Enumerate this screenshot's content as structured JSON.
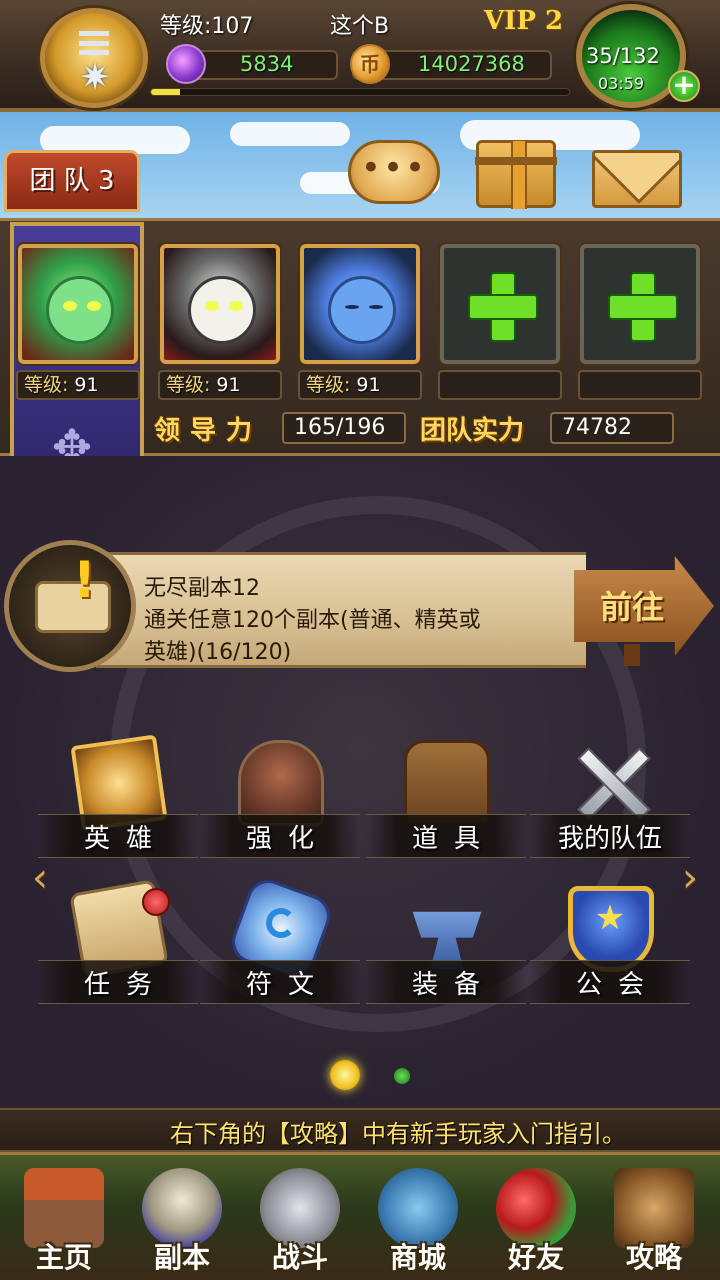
{
  "header": {
    "level_text": "等级:107",
    "player_name": "这个B",
    "vip_text": "VIP 2",
    "gems": "5834",
    "gold": "14027368",
    "gold_icon_glyph": "币",
    "exp_progress": 0.07,
    "stamina": "35/132",
    "stamina_timer": "03:59",
    "stamina_add_glyph": "+"
  },
  "toolbar": {
    "team_tab": "团 队 3",
    "chat_glyph": "•••"
  },
  "team": {
    "slots": [
      {
        "level_label": "等级:",
        "level": "91"
      },
      {
        "level_label": "等级:",
        "level": "91"
      },
      {
        "level_label": "等级:",
        "level": "91"
      },
      {
        "level_label": "",
        "level": ""
      },
      {
        "level_label": "",
        "level": ""
      }
    ],
    "leadership_label": "领导力",
    "leadership_value": "165/196",
    "power_label": "团队实力",
    "power_value": "74782",
    "banner_glyph": "✥"
  },
  "quest": {
    "title": "无尽副本12",
    "desc_line1": "通关任意120个副本(普通、精英或",
    "desc_line2": "英雄)(16/120)",
    "exclaim_glyph": "!",
    "go_label": "前往"
  },
  "menu": {
    "heroes": "英雄",
    "enhance": "强化",
    "items": "道具",
    "myteam": "我的队伍",
    "quests": "任务",
    "runes": "符文",
    "equipment": "装备",
    "guild": "公会",
    "arrow_left": "‹",
    "arrow_right": "›",
    "guild_star": "★"
  },
  "ticker": {
    "text": "右下角的【攻略】中有新手玩家入门指引。"
  },
  "nav": {
    "home": "主页",
    "dungeon": "副本",
    "battle": "战斗",
    "shop": "商城",
    "friends": "好友",
    "guide": "攻略"
  },
  "icons": {
    "menu": "menu-icon",
    "gem": "gem-icon",
    "gold": "gold-coin-icon",
    "chat": "chat-bubble-icon",
    "gift": "gift-icon",
    "mail": "mail-icon"
  },
  "colors": {
    "accent_gold": "#ffd860",
    "resource_green": "#7ff07a",
    "vip_yellow": "#ffd84a"
  }
}
